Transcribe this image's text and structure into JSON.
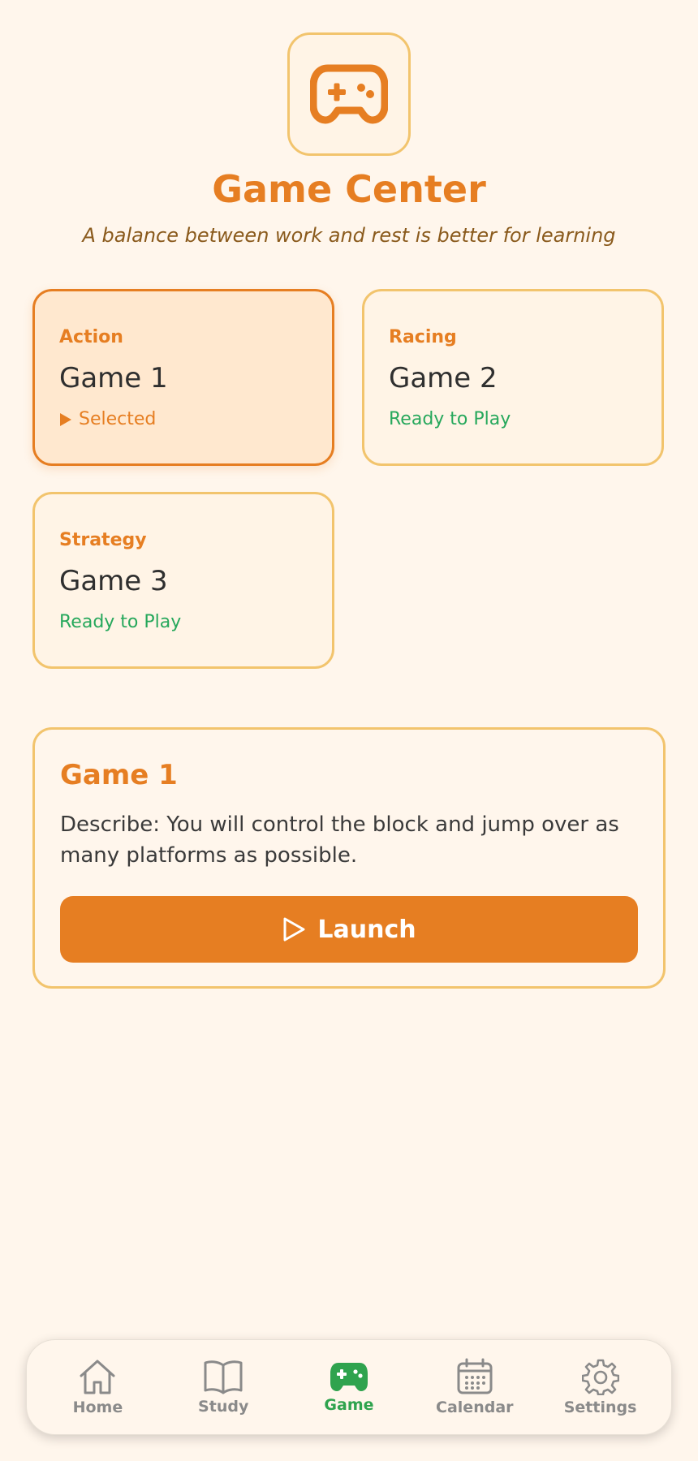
{
  "header": {
    "icon": "gamepad-icon",
    "title": "Game Center",
    "subtitle": "A balance between work and rest is better for learning"
  },
  "games": [
    {
      "category": "Action",
      "name": "Game 1",
      "status": "Selected",
      "selected": true
    },
    {
      "category": "Racing",
      "name": "Game 2",
      "status": "Ready to Play",
      "selected": false
    },
    {
      "category": "Strategy",
      "name": "Game 3",
      "status": "Ready to Play",
      "selected": false
    }
  ],
  "detail": {
    "title": "Game 1",
    "description": "Describe: You will control the block and jump over as many platforms as possible.",
    "launch_label": "Launch",
    "launch_icon": "play-icon"
  },
  "nav": {
    "items": [
      {
        "label": "Home",
        "icon": "home-icon",
        "active": false
      },
      {
        "label": "Study",
        "icon": "book-icon",
        "active": false
      },
      {
        "label": "Game",
        "icon": "gamepad-icon",
        "active": true
      },
      {
        "label": "Calendar",
        "icon": "calendar-icon",
        "active": false
      },
      {
        "label": "Settings",
        "icon": "gear-icon",
        "active": false
      }
    ]
  },
  "colors": {
    "accent": "#e67e22",
    "ready": "#27a85c",
    "background": "#fff6ec",
    "border": "#f2c46d",
    "nav_active": "#2fa34e"
  }
}
